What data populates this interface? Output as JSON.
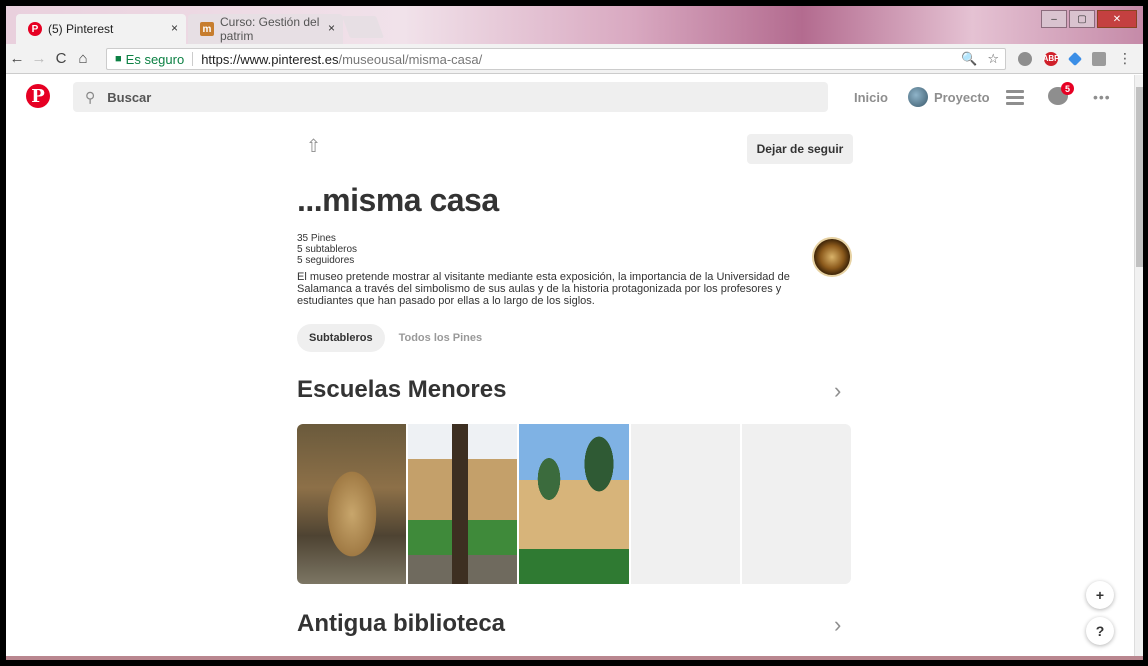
{
  "browser": {
    "tabs": [
      {
        "label": "(5) Pinterest",
        "favicon": "P",
        "close": "×"
      },
      {
        "label": "Curso: Gestión del patrim",
        "favicon": "m",
        "close": "×"
      }
    ],
    "window_controls": {
      "minimize": "–",
      "maximize": "▢",
      "close": "✕"
    },
    "nav": {
      "back": "←",
      "forward": "→",
      "reload": "C",
      "home": "⌂"
    },
    "address": {
      "secure_label": "Es seguro",
      "url_host": "https://www.pinterest.es",
      "url_path": "/museousal/misma-casa/",
      "zoom_icon": "🔍",
      "star_icon": "☆"
    },
    "extensions": {
      "abp_label": "ABP",
      "menu": "⋮"
    }
  },
  "pinterest": {
    "logo": "P",
    "search_placeholder": "Buscar",
    "nav": {
      "home": "Inicio",
      "profile": "Proyecto"
    },
    "notification_count": "5",
    "more": "•••"
  },
  "board": {
    "share_icon": "⇧",
    "unfollow_label": "Dejar de seguir",
    "title": "...misma casa",
    "stats": {
      "pins": "35 Pines",
      "subboards": "5 subtableros",
      "followers": "5 seguidores"
    },
    "description": "El museo pretende mostrar al visitante mediante esta exposición, la importancia de la Universidad de Salamanca a través del simbolismo de sus aulas y de la historia protagonizada por los profesores y estudiantes que han pasado por ellas a lo largo de los siglos.",
    "tabs": {
      "subboards": "Subtableros",
      "all_pins": "Todos los Pines"
    }
  },
  "sections": [
    {
      "title": "Escuelas Menores",
      "chevron": "›"
    },
    {
      "title": "Antigua biblioteca",
      "chevron": "›"
    }
  ],
  "fab": {
    "add": "+",
    "help": "?"
  },
  "colors": {
    "brand": "#e60023",
    "pill": "#efefef",
    "text": "#333333"
  }
}
